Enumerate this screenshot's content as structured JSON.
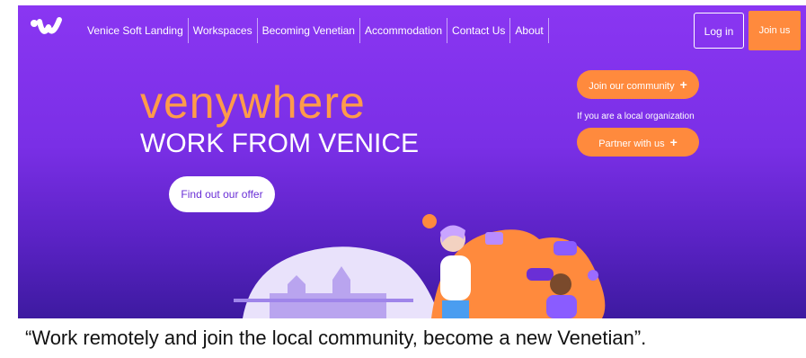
{
  "nav": {
    "items": [
      "Venice Soft Landing",
      "Workspaces",
      "Becoming Venetian",
      "Accommodation",
      "Contact Us",
      "About"
    ],
    "login_label": "Log in",
    "join_label": "Join us"
  },
  "hero": {
    "title": "venywhere",
    "subtitle": "WORK FROM VENICE",
    "offer_button": "Find out our offer",
    "community_button": "Join our community",
    "local_org_text": "If you are a local organization",
    "partner_button": "Partner with us"
  },
  "caption": "“Work remotely and join the local community, become a new Venetian”.",
  "colors": {
    "purple": "#8a36f2",
    "orange": "#ff8a3d",
    "title_orange": "#ff9b4a"
  },
  "icons": [
    "venywhere-logo",
    "plus-icon",
    "venice-illustration"
  ]
}
